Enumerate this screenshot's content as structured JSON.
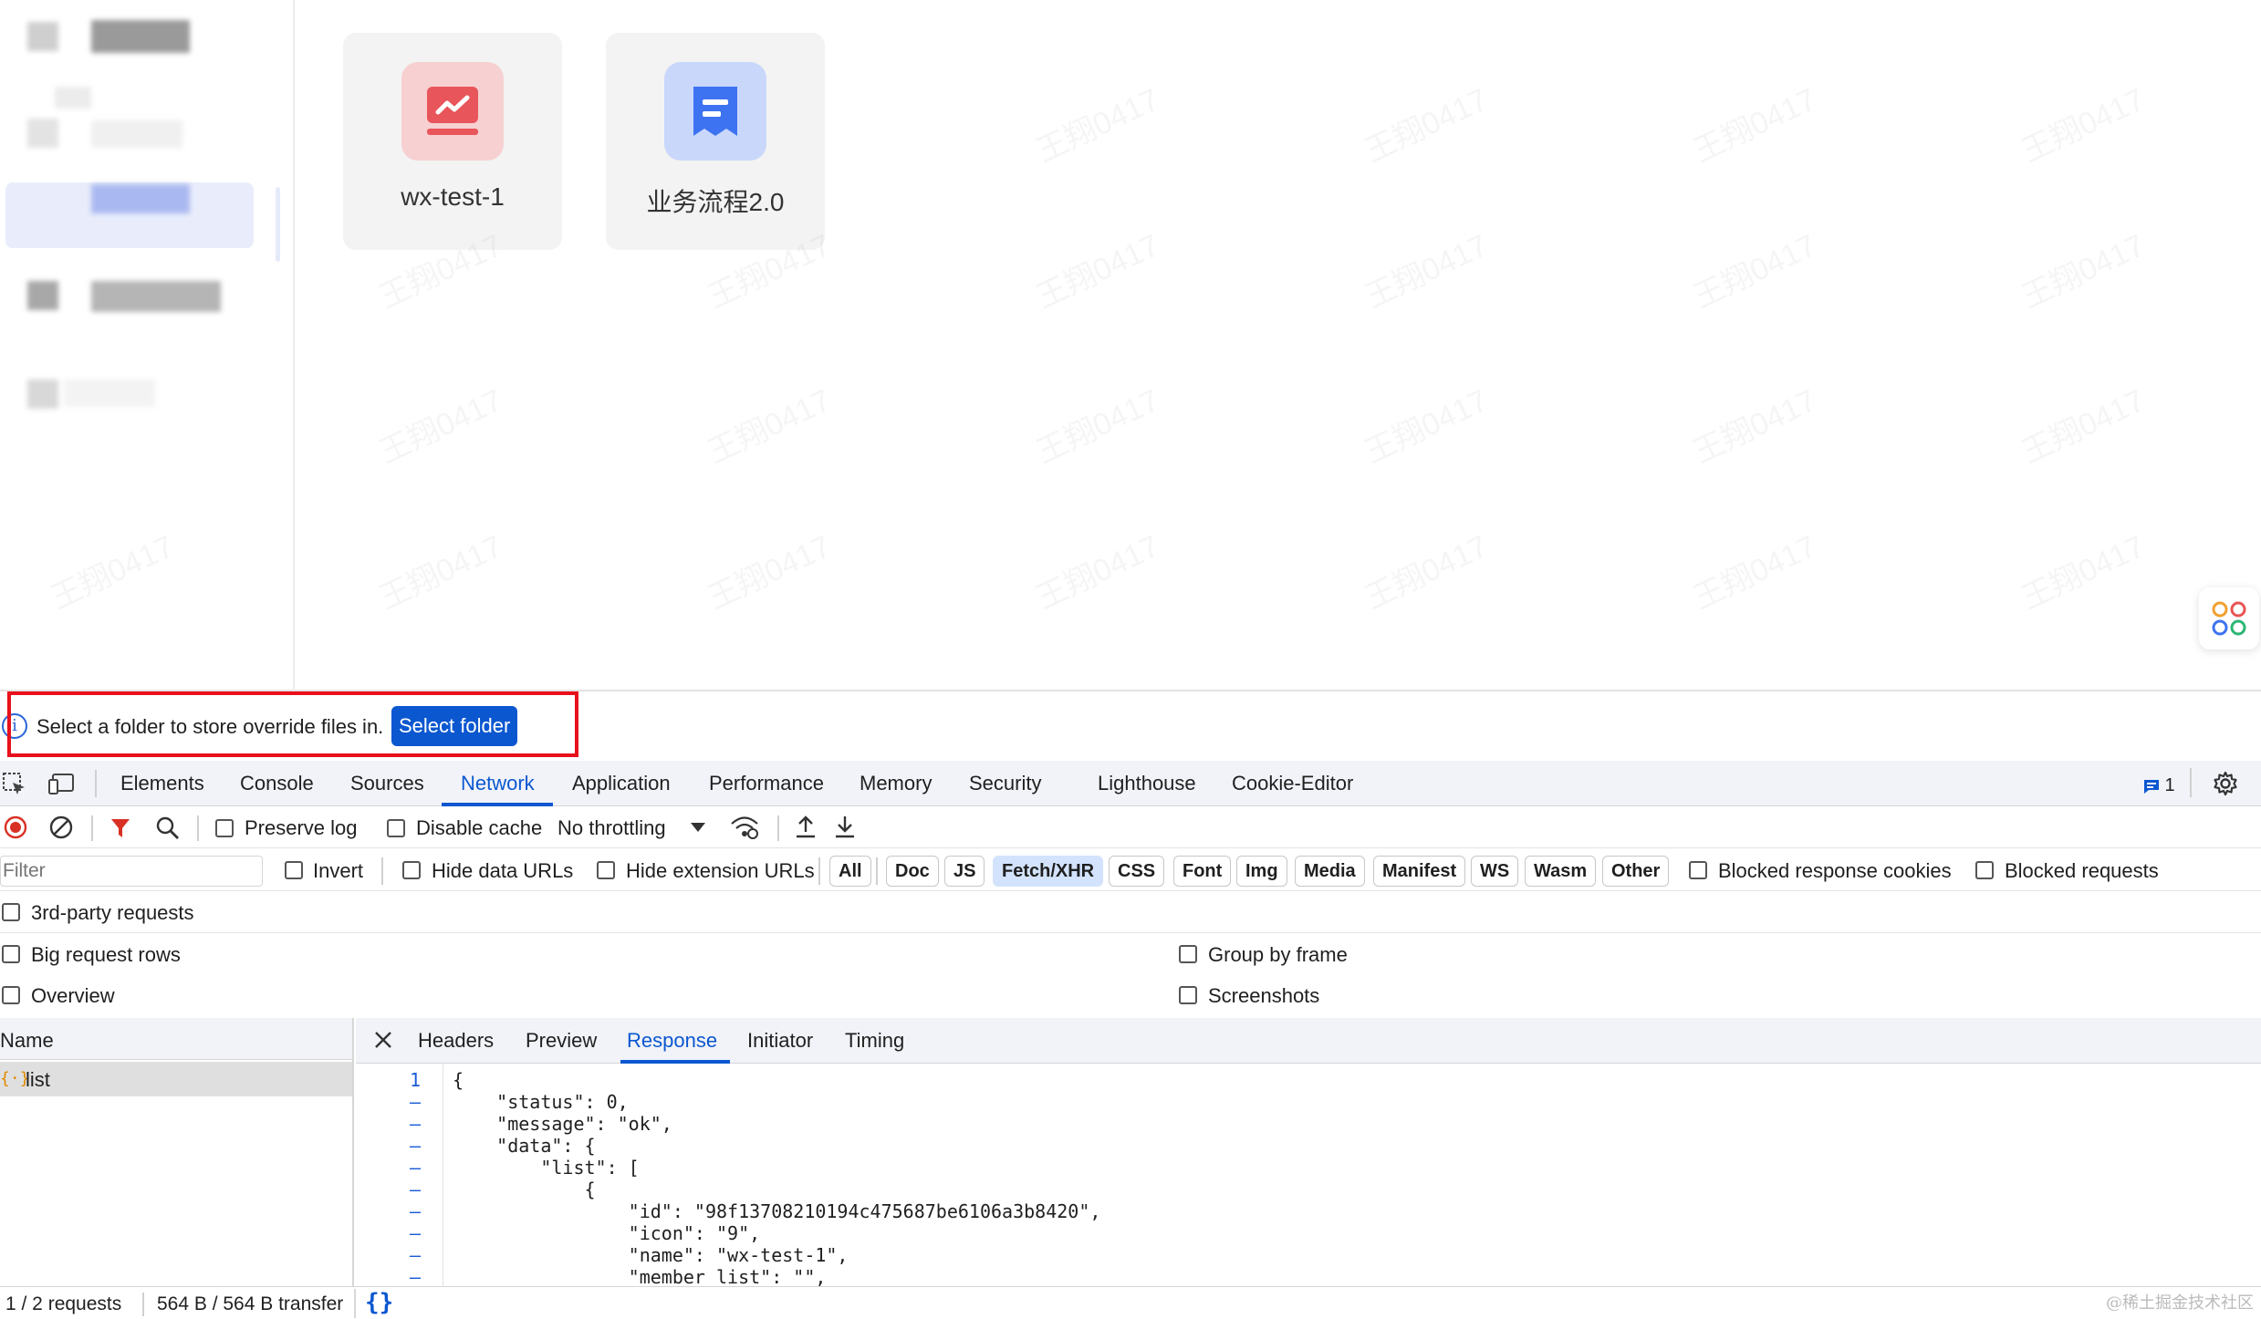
{
  "app": {
    "cards": [
      {
        "name": "wx-test-1",
        "icon": "chart-icon",
        "color": "#e8555a",
        "bg": "#f7d0d1"
      },
      {
        "name": "业务流程2.0",
        "icon": "document-icon",
        "color": "#3d73f0",
        "bg": "#c9d7fb"
      }
    ],
    "watermark": "王翔0417"
  },
  "banner": {
    "message": "Select a folder to store override files in.",
    "button": "Select folder"
  },
  "devtools": {
    "tabs": [
      "Elements",
      "Console",
      "Sources",
      "Network",
      "Application",
      "Performance",
      "Memory",
      "Security",
      "Lighthouse",
      "Cookie-Editor"
    ],
    "active_tab": "Network",
    "issues_count": "1",
    "toolbar": {
      "preserve_log": "Preserve log",
      "disable_cache": "Disable cache",
      "throttling": "No throttling"
    },
    "filter": {
      "placeholder": "Filter",
      "invert": "Invert",
      "hide_data_urls": "Hide data URLs",
      "hide_extension_urls": "Hide extension URLs",
      "types": [
        "All",
        "Doc",
        "JS",
        "Fetch/XHR",
        "CSS",
        "Font",
        "Img",
        "Media",
        "Manifest",
        "WS",
        "Wasm",
        "Other"
      ],
      "active_type": "Fetch/XHR",
      "blocked_response_cookies": "Blocked response cookies",
      "blocked_requests": "Blocked requests"
    },
    "options": {
      "third_party": "3rd-party requests",
      "big_rows": "Big request rows",
      "group_by_frame": "Group by frame",
      "overview": "Overview",
      "screenshots": "Screenshots"
    },
    "names": {
      "header": "Name",
      "rows": [
        "list"
      ]
    },
    "detail_tabs": [
      "Headers",
      "Preview",
      "Response",
      "Initiator",
      "Timing"
    ],
    "active_detail_tab": "Response",
    "response_lines": [
      {
        "num": "1",
        "text": "{"
      },
      {
        "num": "–",
        "text": "    \"status\": 0,"
      },
      {
        "num": "–",
        "text": "    \"message\": \"ok\","
      },
      {
        "num": "–",
        "text": "    \"data\": {"
      },
      {
        "num": "–",
        "text": "        \"list\": ["
      },
      {
        "num": "–",
        "text": "            {"
      },
      {
        "num": "–",
        "text": "                \"id\": \"98f13708210194c475687be6106a3b8420\","
      },
      {
        "num": "–",
        "text": "                \"icon\": \"9\","
      },
      {
        "num": "–",
        "text": "                \"name\": \"wx-test-1\","
      },
      {
        "num": "–",
        "text": "                \"member_list\": \"\","
      }
    ],
    "status": {
      "requests": "1 / 2 requests",
      "transfer": "564 B / 564 B transfer"
    }
  },
  "credit": "@稀土掘金技术社区"
}
